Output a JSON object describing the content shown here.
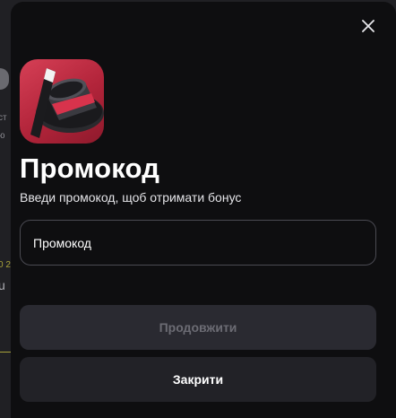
{
  "background": {
    "fragments": [
      "ст",
      "ю",
      "0 2",
      "u"
    ]
  },
  "modal": {
    "close_icon": "close-icon",
    "app_icon": "magic-hat-icon",
    "title": "Промокод",
    "subtitle": "Введи промокод, щоб отримати бонус",
    "promo_input": {
      "placeholder": "Промокод",
      "value": ""
    },
    "continue_button": {
      "label": "Продовжити",
      "state": "disabled"
    },
    "close_button": {
      "label": "Закрити"
    }
  },
  "colors": {
    "modal_bg": "#0e0e10",
    "icon_red": "#c8324a",
    "button_disabled_bg": "#2a2a31",
    "button_bg": "#222227",
    "accent_yellow": "#a8a23a"
  }
}
